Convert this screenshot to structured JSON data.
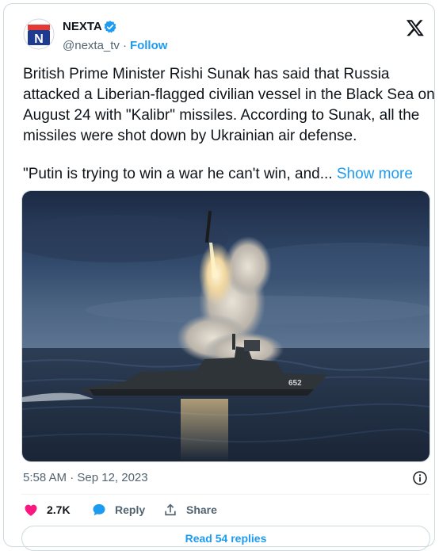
{
  "tweet": {
    "author": {
      "name": "NEXTA",
      "handle": "@nexta_tv",
      "follow_label": "Follow",
      "avatar_letter": "N"
    },
    "text_paragraphs": [
      "British Prime Minister Rishi Sunak has said that Russia attacked a Liberian-flagged civilian vessel in the Black Sea on August 24 with \"Kalibr\" missiles. According to Sunak, all the missiles were shot down by Ukrainian air defense.",
      "\"Putin is trying to win a war he can't win, and..."
    ],
    "show_more_label": "Show more",
    "media": {
      "hull_number": "652"
    },
    "timestamp": "5:58 AM · Sep 12, 2023",
    "actions": {
      "likes_count": "2.7K",
      "reply_label": "Reply",
      "share_label": "Share"
    },
    "read_replies_label": "Read 54 replies"
  },
  "colors": {
    "accent": "#1d9bf0",
    "like": "#f91880",
    "muted_text": "#536471",
    "border": "#cfd9de",
    "brand_red": "#e53935",
    "brand_blue": "#1e3b8f"
  },
  "icons": [
    "x-logo-icon",
    "verified-badge-icon",
    "info-icon",
    "heart-icon",
    "reply-bubble-icon",
    "share-icon"
  ]
}
